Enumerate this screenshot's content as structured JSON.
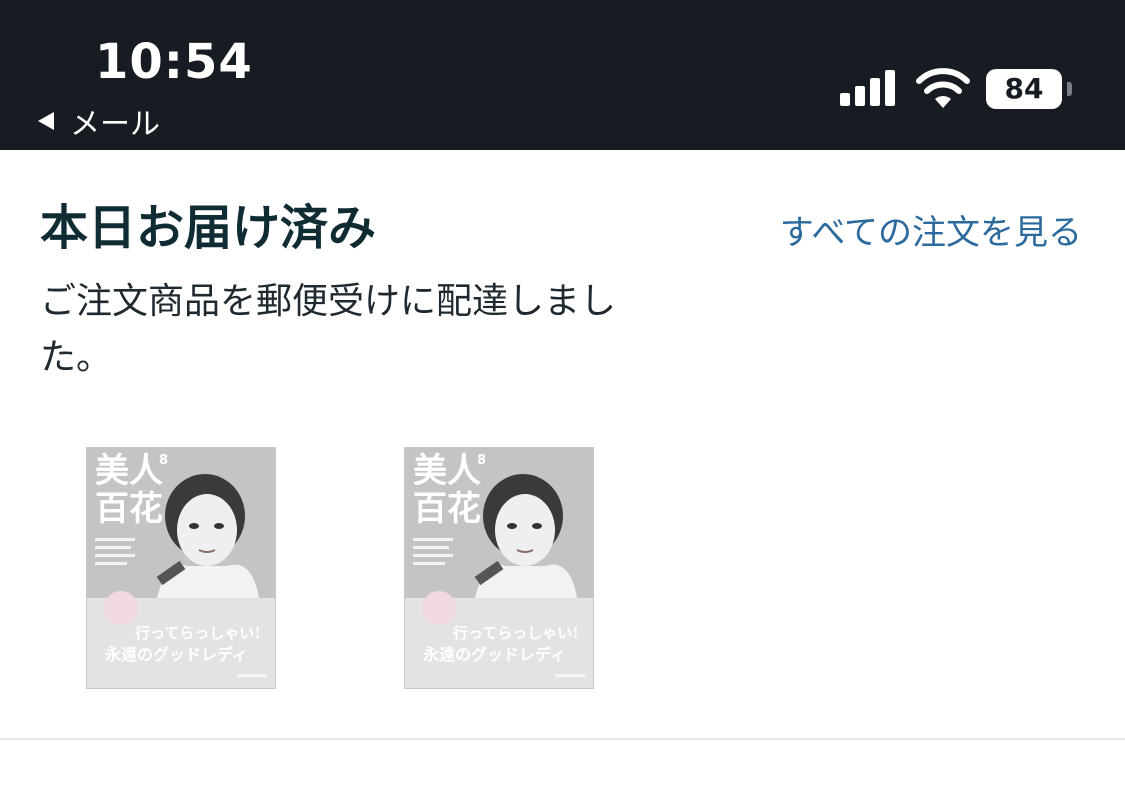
{
  "status_bar": {
    "time": "10:54",
    "back_label": "メール",
    "battery": "84"
  },
  "delivery": {
    "title": "本日お届け済み",
    "description": "ご注文商品を郵便受けに配達しました。",
    "all_orders_link": "すべての注文を見る"
  },
  "products": [
    {
      "name": "magazine-cover",
      "cover_masthead": "美人",
      "cover_masthead_2": "百花",
      "issue": "8",
      "cover_line_1": "行ってらっしゃい!",
      "cover_line_2": "永遠のグッドレディ"
    },
    {
      "name": "magazine-cover",
      "cover_masthead": "美人",
      "cover_masthead_2": "百花",
      "issue": "8",
      "cover_line_1": "行ってらっしゃい!",
      "cover_line_2": "永遠のグッドレディ"
    }
  ],
  "colors": {
    "status_bar_bg": "#171c22",
    "title": "#0f2b33",
    "link": "#2c6a9e"
  }
}
